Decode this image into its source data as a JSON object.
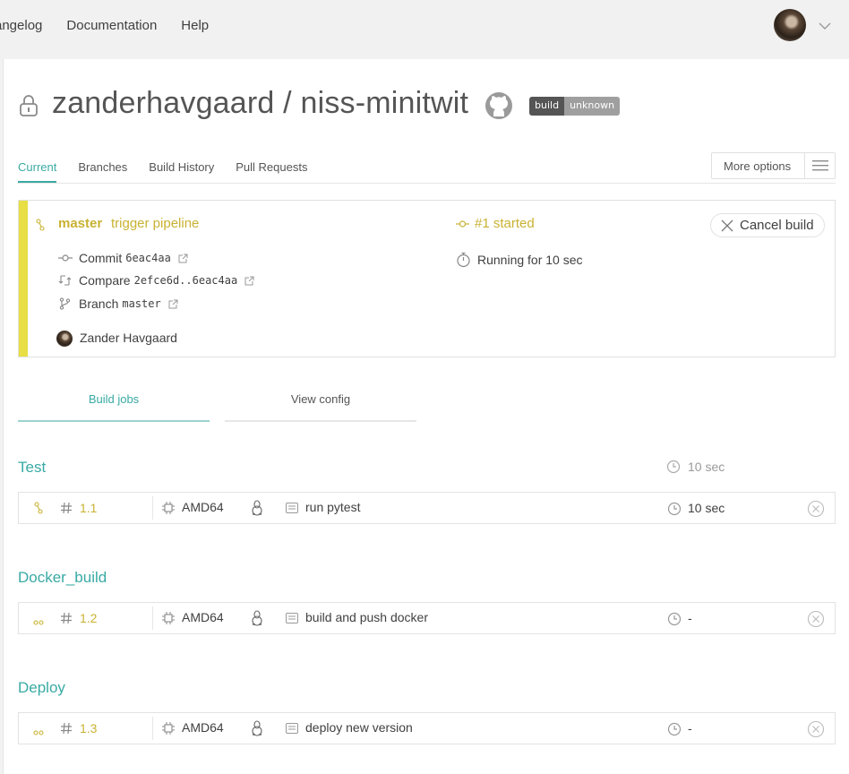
{
  "topnav": {
    "items": [
      "angelog",
      "Documentation",
      "Help"
    ]
  },
  "repo": {
    "title": "zanderhavgaard / niss-minitwit",
    "badge_left": "build",
    "badge_right": "unknown"
  },
  "tabs": [
    "Current",
    "Branches",
    "Build History",
    "Pull Requests"
  ],
  "more_options": "More options",
  "build": {
    "branch": "master",
    "trigger": "trigger pipeline",
    "commit_label": "Commit",
    "commit_sha": "6eac4aa",
    "compare_label": "Compare",
    "compare_range": "2efce6d..6eac4aa",
    "branch_label": "Branch",
    "branch_name": "master",
    "author": "Zander Havgaard",
    "status": "#1 started",
    "running": "Running for 10 sec",
    "cancel": "Cancel build"
  },
  "job_tabs": [
    "Build jobs",
    "View config"
  ],
  "stages": [
    {
      "title": "Test",
      "duration": "10 sec",
      "job": {
        "number": "1.1",
        "arch": "AMD64",
        "name": "run pytest",
        "duration": "10 sec"
      }
    },
    {
      "title": "Docker_build",
      "job": {
        "number": "1.2",
        "arch": "AMD64",
        "name": "build and push docker",
        "duration": "-"
      }
    },
    {
      "title": "Deploy",
      "job": {
        "number": "1.3",
        "arch": "AMD64",
        "name": "deploy new version",
        "duration": "-"
      }
    }
  ],
  "colors": {
    "accent": "#39aaa4",
    "started": "#c9b232",
    "stripe": "#e8de45"
  }
}
